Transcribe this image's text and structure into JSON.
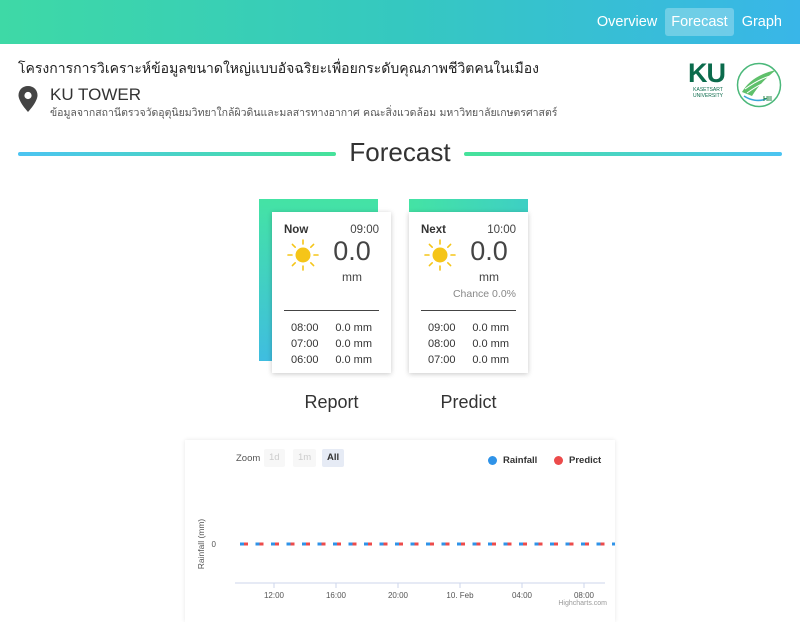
{
  "nav": {
    "items": [
      "Overview",
      "Forecast",
      "Graph"
    ],
    "active": 1
  },
  "header": {
    "project_title": "โครงการการวิเคราะห์ข้อมูลขนาดใหญ่แบบอัจฉริยะเพื่อยกระดับคุณภาพชีวิตคนในเมือง",
    "station_name": "KU TOWER",
    "station_desc": "ข้อมูลจากสถานีตรวจวัดอุตุนิยมวิทยาใกล้ผิวดินและมลสารทางอากาศ คณะสิ่งแวดล้อม มหาวิทยาลัยเกษตรศาสตร์",
    "ku_logo": {
      "letters": "KU",
      "line1": "KASETSART",
      "line2": "UNIVERSITY"
    },
    "hii_logo": {
      "text": "HII"
    }
  },
  "section_title": "Forecast",
  "report": {
    "label": "Now",
    "time": "09:00",
    "value": "0.0",
    "unit": "mm",
    "caption": "Report",
    "history": [
      {
        "time": "08:00",
        "value": "0.0 mm"
      },
      {
        "time": "07:00",
        "value": "0.0 mm"
      },
      {
        "time": "06:00",
        "value": "0.0 mm"
      }
    ]
  },
  "predict": {
    "label": "Next",
    "time": "10:00",
    "value": "0.0",
    "unit": "mm",
    "chance": "Chance 0.0%",
    "caption": "Predict",
    "history": [
      {
        "time": "09:00",
        "value": "0.0 mm"
      },
      {
        "time": "08:00",
        "value": "0.0 mm"
      },
      {
        "time": "07:00",
        "value": "0.0 mm"
      }
    ]
  },
  "chart": {
    "zoom_label": "Zoom",
    "zoom_options": [
      "1d",
      "1m",
      "All"
    ],
    "zoom_active": 2,
    "credit": "Highcharts.com"
  },
  "chart_data": {
    "type": "bar",
    "ylabel": "Rainfall (mm)",
    "xlabel": "",
    "x_tick_labels": [
      "12:00",
      "16:00",
      "20:00",
      "10. Feb",
      "04:00",
      "08:00"
    ],
    "y_tick_labels": [
      "0"
    ],
    "legend_position": "top-right",
    "series": [
      {
        "name": "Rainfall",
        "color": "#2f93e8",
        "values": [
          0,
          0,
          0,
          0,
          0,
          0,
          0,
          0,
          0,
          0,
          0,
          0,
          0,
          0,
          0,
          0,
          0,
          0,
          0,
          0,
          0,
          0,
          0,
          0,
          0
        ]
      },
      {
        "name": "Predict",
        "color": "#ec4b4b",
        "values": [
          0,
          0,
          0,
          0,
          0,
          0,
          0,
          0,
          0,
          0,
          0,
          0,
          0,
          0,
          0,
          0,
          0,
          0,
          0,
          0,
          0,
          0,
          0,
          0,
          0
        ]
      }
    ],
    "colors": {
      "rainfall": "#2f93e8",
      "predict": "#ec4b4b"
    }
  },
  "colors": {
    "accent_green": "#44e3a4",
    "accent_blue": "#39b6e8",
    "sun": "#f5c518"
  },
  "icons": {
    "location": "map-pin-icon",
    "weather": "sun-icon"
  }
}
